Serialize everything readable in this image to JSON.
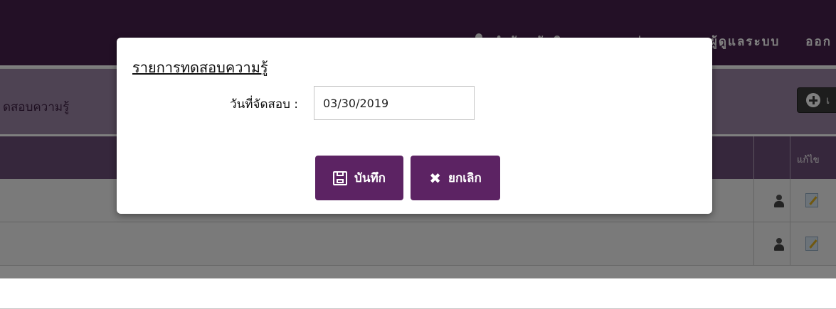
{
  "header": {
    "org_text": "สำนักสวัสดิภาพการขนส่งทางบก : ผู้ดูแลระบบ",
    "logout_text": "ออก"
  },
  "subheader": {
    "title": "ดสอบความรู้",
    "add_button_label": "เ"
  },
  "table": {
    "edit_header": "แก้ไข",
    "rows": [
      {
        "profile_icon": "person-icon",
        "edit_icon": "edit-icon"
      },
      {
        "profile_icon": "person-icon",
        "edit_icon": "edit-icon"
      }
    ]
  },
  "modal": {
    "title": "รายการทดสอบความรู้",
    "date_label": "วันที่จัดสอบ :",
    "date_value": "03/30/2019",
    "save_label": "บันทึก",
    "cancel_label": "ยกเลิก",
    "save_icon": "floppy-disk-icon",
    "cancel_icon": "x-icon"
  },
  "colors": {
    "header_bg": "#47204d",
    "button_bg": "#5c2363",
    "table_header_bg": "#6d4f78"
  }
}
